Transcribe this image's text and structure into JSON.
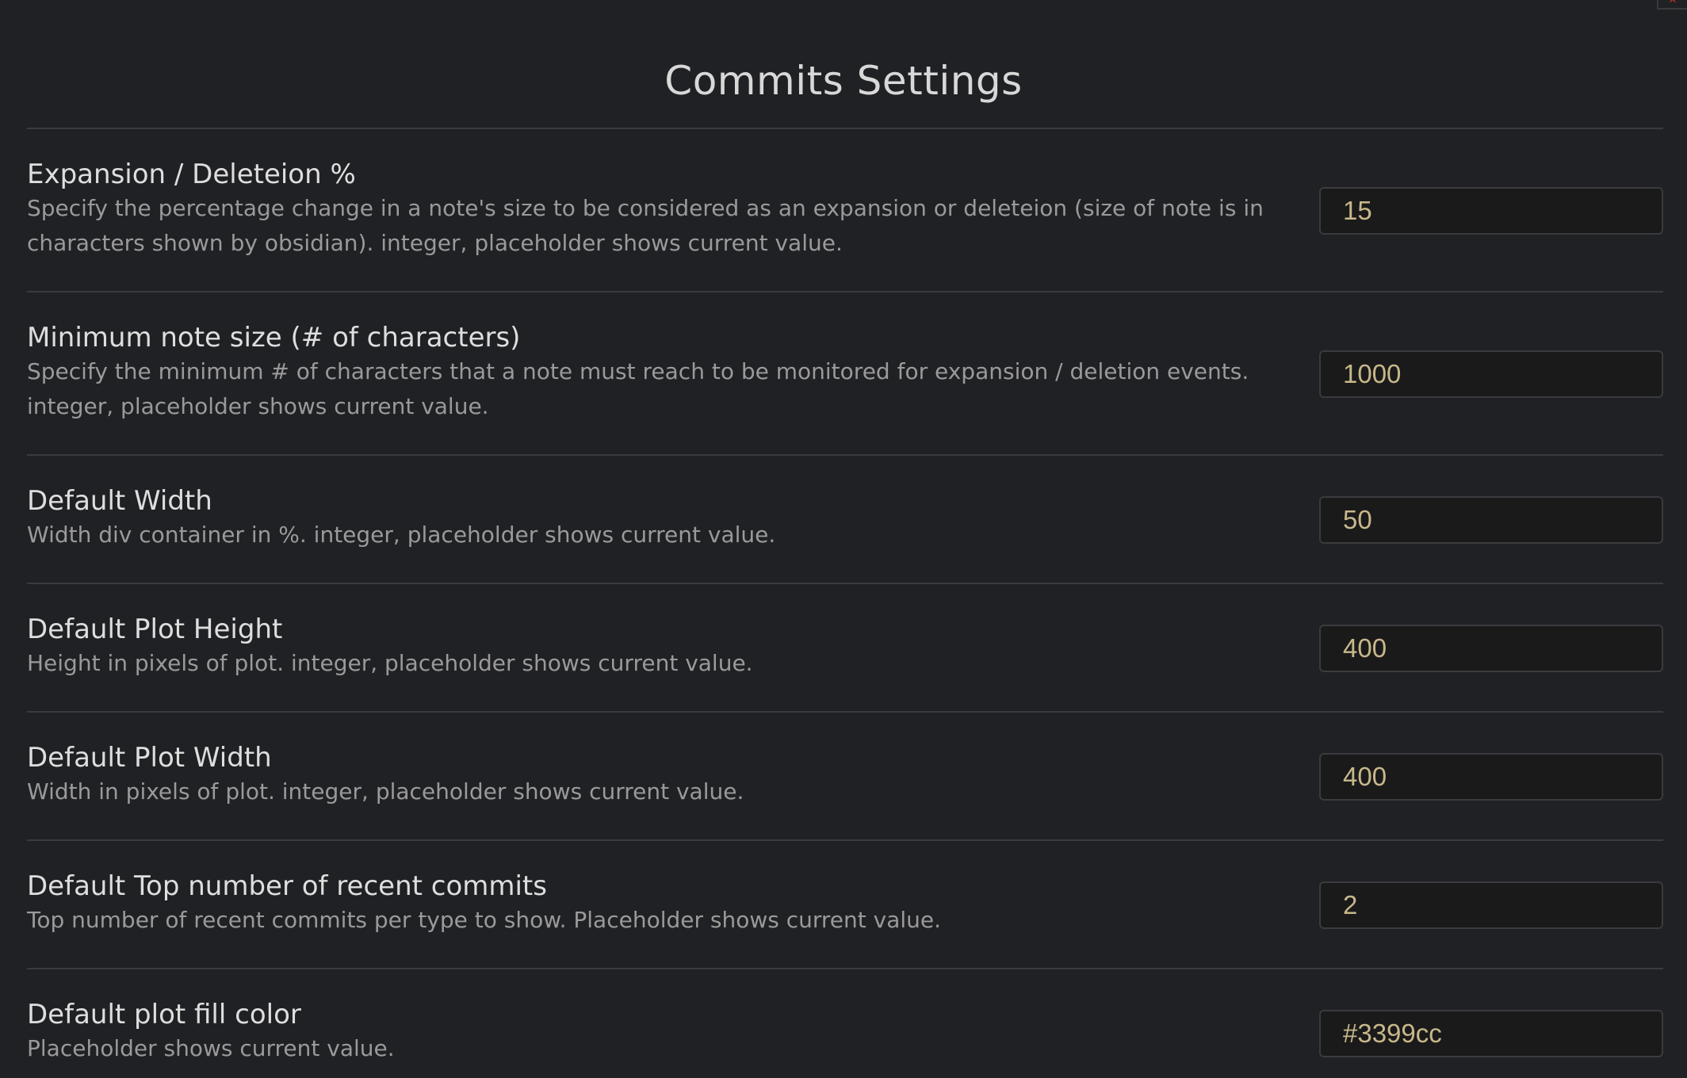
{
  "page": {
    "title": "Commits Settings",
    "close_glyph": "✕"
  },
  "settings": [
    {
      "name": "Expansion / Deleteion %",
      "description": "Specify the percentage change in a note's size to be considered as an expansion or deleteion (size of note is in characters shown by obsidian). integer, placeholder shows current value.",
      "placeholder": "15"
    },
    {
      "name": "Minimum note size (# of characters)",
      "description": "Specify the minimum # of characters that a note must reach to be monitored for expansion / deletion events. integer, placeholder shows current value.",
      "placeholder": "1000"
    },
    {
      "name": "Default Width",
      "description": "Width div container in %. integer, placeholder shows current value.",
      "placeholder": "50"
    },
    {
      "name": "Default Plot Height",
      "description": "Height in pixels of plot. integer, placeholder shows current value.",
      "placeholder": "400"
    },
    {
      "name": "Default Plot Width",
      "description": "Width in pixels of plot. integer, placeholder shows current value.",
      "placeholder": "400"
    },
    {
      "name": "Default Top number of recent commits",
      "description": "Top number of recent commits per type to show. Placeholder shows current value.",
      "placeholder": "2"
    },
    {
      "name": "Default plot fill color",
      "description": "Placeholder shows current value.",
      "placeholder": "#3399cc"
    }
  ]
}
